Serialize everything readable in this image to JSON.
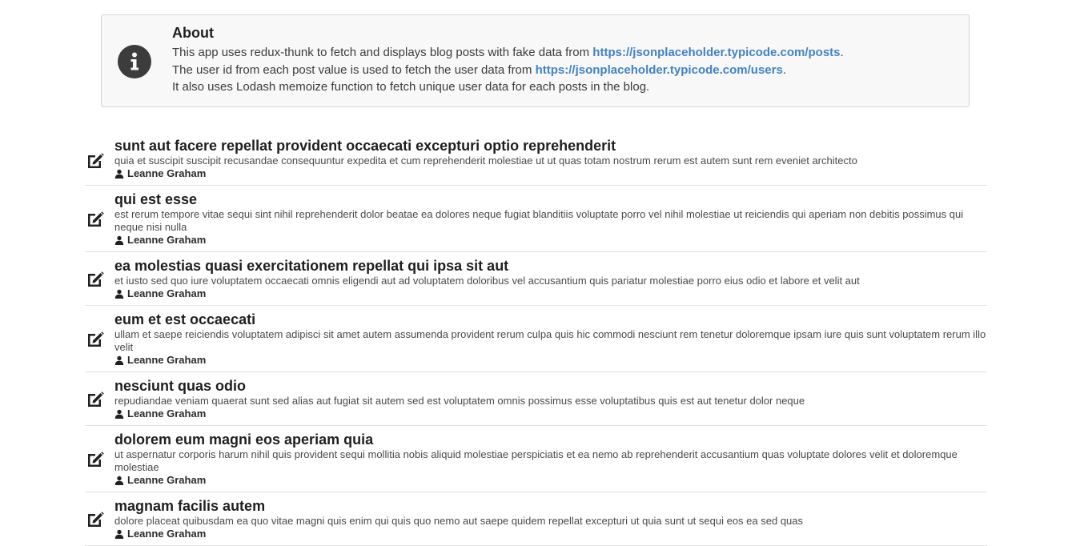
{
  "about": {
    "title": "About",
    "line1_text": "This app uses redux-thunk to fetch and displays blog posts with fake data from ",
    "line1_link": "https://jsonplaceholder.typicode.com/posts",
    "line1_end": ".",
    "line2_text": "The user id from each post value is used to fetch the user data from ",
    "line2_link": "https://jsonplaceholder.typicode.com/users",
    "line2_end": ".",
    "line3_text": "It also uses Lodash memoize function to fetch unique user data for each posts in the blog.",
    "icon": "info-circle-icon"
  },
  "posts": [
    {
      "title": "sunt aut facere repellat provident occaecati excepturi optio reprehenderit",
      "body": "quia et suscipit suscipit recusandae consequuntur expedita et cum reprehenderit molestiae ut ut quas totam nostrum rerum est autem sunt rem eveniet architecto",
      "author": "Leanne Graham"
    },
    {
      "title": "qui est esse",
      "body": "est rerum tempore vitae sequi sint nihil reprehenderit dolor beatae ea dolores neque fugiat blanditiis voluptate porro vel nihil molestiae ut reiciendis qui aperiam non debitis possimus qui neque nisi nulla",
      "author": "Leanne Graham"
    },
    {
      "title": "ea molestias quasi exercitationem repellat qui ipsa sit aut",
      "body": "et iusto sed quo iure voluptatem occaecati omnis eligendi aut ad voluptatem doloribus vel accusantium quis pariatur molestiae porro eius odio et labore et velit aut",
      "author": "Leanne Graham"
    },
    {
      "title": "eum et est occaecati",
      "body": "ullam et saepe reiciendis voluptatem adipisci sit amet autem assumenda provident rerum culpa quis hic commodi nesciunt rem tenetur doloremque ipsam iure quis sunt voluptatem rerum illo velit",
      "author": "Leanne Graham"
    },
    {
      "title": "nesciunt quas odio",
      "body": "repudiandae veniam quaerat sunt sed alias aut fugiat sit autem sed est voluptatem omnis possimus esse voluptatibus quis est aut tenetur dolor neque",
      "author": "Leanne Graham"
    },
    {
      "title": "dolorem eum magni eos aperiam quia",
      "body": "ut aspernatur corporis harum nihil quis provident sequi mollitia nobis aliquid molestiae perspiciatis et ea nemo ab reprehenderit accusantium quas voluptate dolores velit et doloremque molestiae",
      "author": "Leanne Graham"
    },
    {
      "title": "magnam facilis autem",
      "body": "dolore placeat quibusdam ea quo vitae magni quis enim qui quis quo nemo aut saepe quidem repellat excepturi ut quia sunt ut sequi eos ea sed quas",
      "author": "Leanne Graham"
    }
  ],
  "icons": {
    "post": "edit-icon",
    "author": "user-icon"
  }
}
